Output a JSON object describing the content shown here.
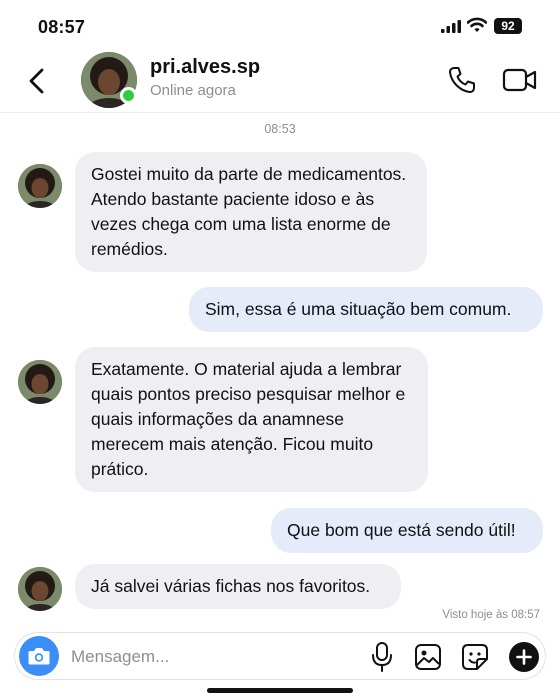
{
  "status_bar": {
    "time": "08:57",
    "battery": "92"
  },
  "header": {
    "contact_name": "pri.alves.sp",
    "contact_status": "Online agora"
  },
  "conversation": {
    "timestamp": "08:53",
    "messages": [
      {
        "direction": "incoming",
        "text": "Gostei muito da parte de medicamentos. Atendo bastante paciente idoso e às vezes chega com uma lista enorme de remédios."
      },
      {
        "direction": "outgoing",
        "text": "Sim, essa é uma situação bem comum."
      },
      {
        "direction": "incoming",
        "text": "Exatamente. O material ajuda a lembrar quais pontos preciso pesquisar melhor e quais informações da anamnese merecem mais atenção. Ficou muito prático."
      },
      {
        "direction": "outgoing",
        "text": "Que bom que está sendo útil!"
      },
      {
        "direction": "incoming",
        "text": "Já salvei várias fichas nos favoritos."
      }
    ],
    "seen_label": "Visto hoje às 08:57"
  },
  "composer": {
    "placeholder": "Mensagem..."
  },
  "icons": {
    "back": "chevron-left-icon",
    "call": "phone-icon",
    "video": "video-camera-icon",
    "camera": "camera-icon",
    "mic": "microphone-icon",
    "gallery": "image-icon",
    "sticker": "sticker-icon",
    "add": "plus-icon"
  },
  "colors": {
    "incoming_bubble": "#efeff3",
    "outgoing_bubble": "#e6ebfa",
    "online": "#2ecc40",
    "camera_button": "#3a8ef6"
  }
}
